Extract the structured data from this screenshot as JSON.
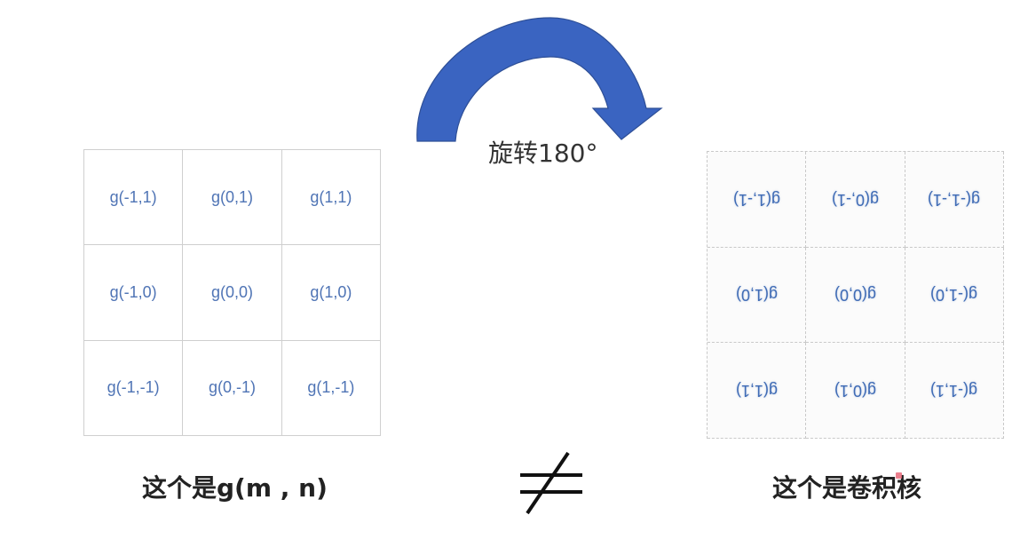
{
  "arrow": {
    "label": "旋转180°",
    "color": "#3a64c1"
  },
  "left_grid": {
    "cells": [
      "g(-1,1)",
      "g(0,1)",
      "g(1,1)",
      "g(-1,0)",
      "g(0,0)",
      "g(1,0)",
      "g(-1,-1)",
      "g(0,-1)",
      "g(1,-1)"
    ]
  },
  "right_grid": {
    "cells": [
      "g(1,-1)",
      "g(0,-1)",
      "g(-1,-1)",
      "g(1,0)",
      "g(0,0)",
      "g(-1,0)",
      "g(1,1)",
      "g(0,1)",
      "g(-1,1)"
    ],
    "rotated_degrees": 180
  },
  "captions": {
    "left": "这个是g(m , n)",
    "right": "这个是卷积核"
  },
  "neq_symbol": "not-equal-icon"
}
